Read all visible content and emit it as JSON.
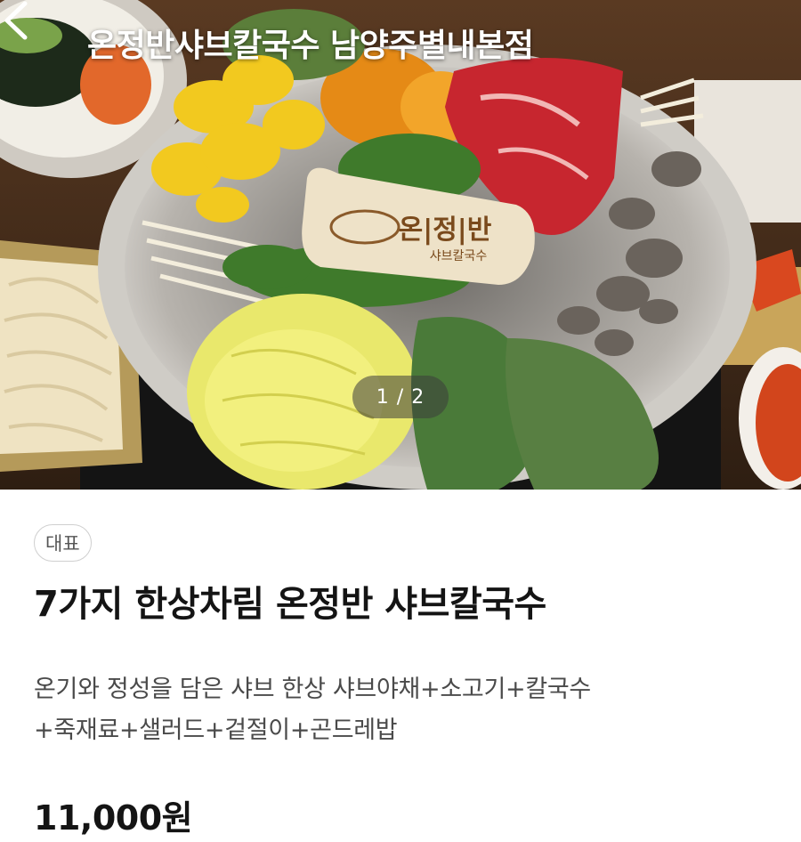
{
  "header": {
    "title": "온정반샤브칼국수 남양주별내본점",
    "back_icon": "chevron-left-icon"
  },
  "photo": {
    "page_indicator": "1 / 2",
    "current_page": 1,
    "total_pages": 2,
    "plate_logo_text": "온|정|반",
    "plate_logo_subtext": "샤브칼국수"
  },
  "menu": {
    "badge": "대표",
    "name": "7가지 한상차림 온정반 샤브칼국수",
    "description_line1": "온기와 정성을 담은 샤브 한상 샤브야채+소고기+칼국수",
    "description_line2": "+죽재료+샐러드+겉절이+곤드레밥",
    "price": "11,000원"
  }
}
